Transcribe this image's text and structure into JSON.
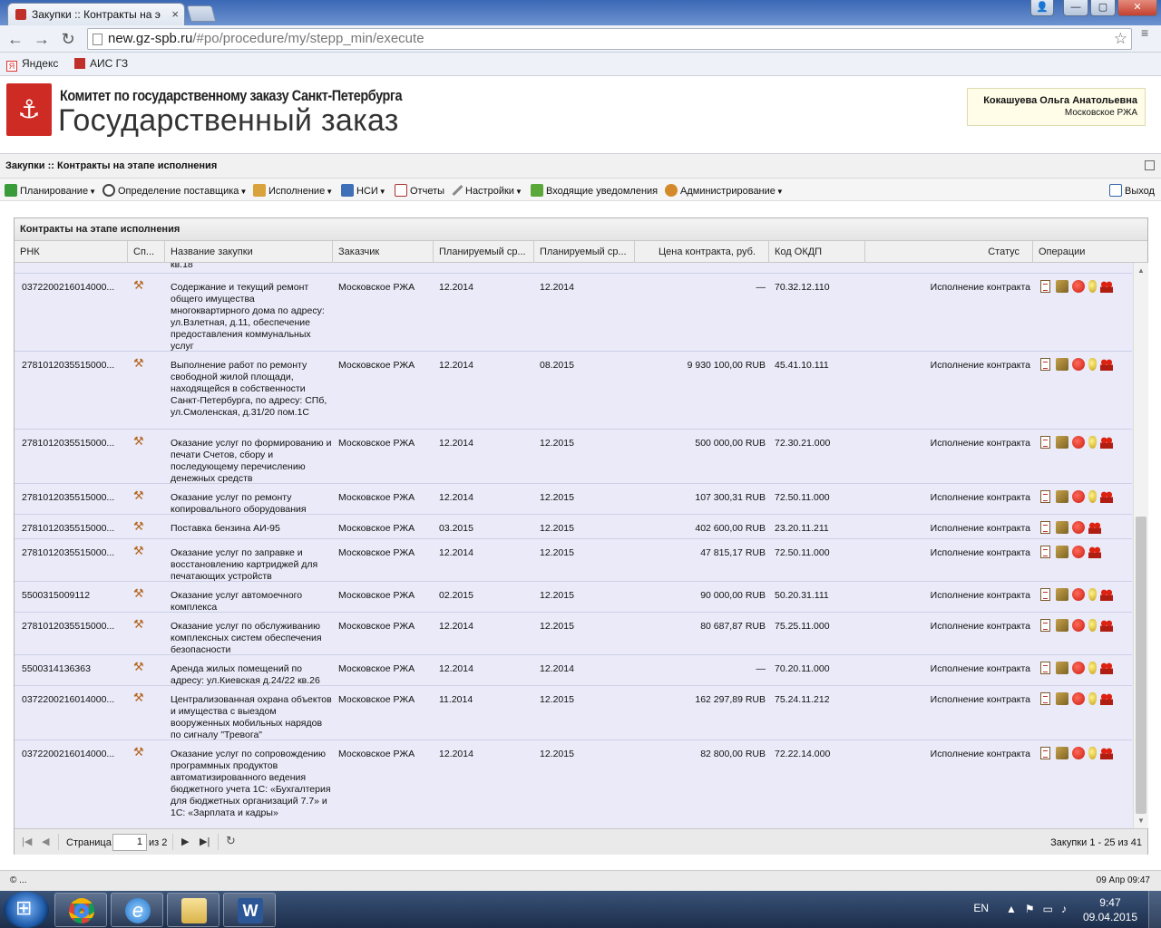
{
  "browser": {
    "tab_title": "Закупки :: Контракты на э",
    "url_domain": "new.gz-spb.ru",
    "url_path": "/#po/procedure/my/stepp_min/execute",
    "bookmarks": [
      "Яндекс",
      "АИС ГЗ"
    ]
  },
  "header": {
    "org_title": "Комитет по государственному заказу Санкт-Петербурга",
    "app_title": "Государственный заказ",
    "user_name": "Кокашуева Ольга Анатольевна",
    "user_org": "Московское РЖА"
  },
  "appbar": {
    "title": "Закупки :: Контракты на этапе исполнения"
  },
  "menu": {
    "items": [
      {
        "label": "Планирование",
        "icon": "planning-icon",
        "dropdown": true
      },
      {
        "label": "Определение поставщика",
        "icon": "supplier-icon",
        "dropdown": true
      },
      {
        "label": "Исполнение",
        "icon": "execution-icon",
        "dropdown": true
      },
      {
        "label": "НСИ",
        "icon": "reference-book-icon",
        "dropdown": true
      },
      {
        "label": "Отчеты",
        "icon": "reports-icon",
        "dropdown": false
      },
      {
        "label": "Настройки",
        "icon": "settings-icon",
        "dropdown": true
      },
      {
        "label": "Входящие уведомления",
        "icon": "notifications-icon",
        "dropdown": false
      },
      {
        "label": "Администрирование",
        "icon": "admin-icon",
        "dropdown": true
      }
    ],
    "logout": "Выход"
  },
  "grid": {
    "title": "Контракты на этапе исполнения",
    "columns": [
      "РНК",
      "Сп...",
      "Название закупки",
      "Заказчик",
      "Планируемый ср...",
      "Планируемый ср...",
      "Цена контракта, руб.",
      "Код ОКДП",
      "Статус",
      "Операции"
    ],
    "partial_row_text": "кв.18",
    "rows": [
      {
        "rnk": "0372200216014000...",
        "name": "Содержание и текущий ремонт общего имущества многоквартирного дома по адресу: ул.Взлетная, д.11, обеспечение предоставления коммунальных услуг",
        "customer": "Московское РЖА",
        "d1": "12.2014",
        "d2": "12.2014",
        "price": "—",
        "okdp": "70.32.12.110",
        "status": "Исполнение контракта",
        "coin": true
      },
      {
        "rnk": "2781012035515000...",
        "name": "Выполнение работ по ремонту свободной жилой площади, находящейся в собственности Санкт-Петербурга, по адресу: СПб, ул.Смоленская, д.31/20 пом.1С",
        "customer": "Московское РЖА",
        "d1": "12.2014",
        "d2": "08.2015",
        "price": "9 930 100,00 RUB",
        "okdp": "45.41.10.111",
        "status": "Исполнение контракта",
        "coin": true
      },
      {
        "rnk": "2781012035515000...",
        "name": "Оказание услуг по формированию и печати Счетов, сбору и последующему перечислению денежных средств",
        "customer": "Московское РЖА",
        "d1": "12.2014",
        "d2": "12.2015",
        "price": "500 000,00 RUB",
        "okdp": "72.30.21.000",
        "status": "Исполнение контракта",
        "coin": true
      },
      {
        "rnk": "2781012035515000...",
        "name": "Оказание услуг по ремонту копировального оборудования",
        "customer": "Московское РЖА",
        "d1": "12.2014",
        "d2": "12.2015",
        "price": "107 300,31 RUB",
        "okdp": "72.50.11.000",
        "status": "Исполнение контракта",
        "coin": true
      },
      {
        "rnk": "2781012035515000...",
        "name": "Поставка бензина АИ-95",
        "customer": "Московское РЖА",
        "d1": "03.2015",
        "d2": "12.2015",
        "price": "402 600,00 RUB",
        "okdp": "23.20.11.211",
        "status": "Исполнение контракта",
        "coin": false
      },
      {
        "rnk": "2781012035515000...",
        "name": "Оказание услуг по заправке и восстановлению картриджей для печатающих устройств",
        "customer": "Московское РЖА",
        "d1": "12.2014",
        "d2": "12.2015",
        "price": "47 815,17 RUB",
        "okdp": "72.50.11.000",
        "status": "Исполнение контракта",
        "coin": false
      },
      {
        "rnk": "5500315009112",
        "name": "Оказание услуг автомоечного комплекса",
        "customer": "Московское РЖА",
        "d1": "02.2015",
        "d2": "12.2015",
        "price": "90 000,00 RUB",
        "okdp": "50.20.31.111",
        "status": "Исполнение контракта",
        "coin": true
      },
      {
        "rnk": "2781012035515000...",
        "name": "Оказание услуг по обслуживанию комплексных систем обеспечения безопасности",
        "customer": "Московское РЖА",
        "d1": "12.2014",
        "d2": "12.2015",
        "price": "80 687,87 RUB",
        "okdp": "75.25.11.000",
        "status": "Исполнение контракта",
        "coin": true
      },
      {
        "rnk": "5500314136363",
        "name": "Аренда жилых помещений по адресу: ул.Киевская д.24/22 кв.26",
        "customer": "Московское РЖА",
        "d1": "12.2014",
        "d2": "12.2014",
        "price": "—",
        "okdp": "70.20.11.000",
        "status": "Исполнение контракта",
        "coin": true
      },
      {
        "rnk": "0372200216014000...",
        "name": "Централизованная охрана объектов и имущества с выездом вооруженных мобильных нарядов по сигналу \"Тревога\"",
        "customer": "Московское РЖА",
        "d1": "11.2014",
        "d2": "12.2015",
        "price": "162 297,89 RUB",
        "okdp": "75.24.11.212",
        "status": "Исполнение контракта",
        "coin": true
      },
      {
        "rnk": "0372200216014000...",
        "name": "Оказание услуг по сопровождению программных продуктов автоматизированного ведения бюджетного учета 1С: «Бухгалтерия для бюджетных организаций 7.7» и 1С: «Зарплата и кадры»",
        "customer": "Московское РЖА",
        "d1": "12.2014",
        "d2": "12.2015",
        "price": "82 800,00 RUB",
        "okdp": "72.22.14.000",
        "status": "Исполнение контракта",
        "coin": true
      }
    ]
  },
  "pager": {
    "page_label": "Страница",
    "page_value": "1",
    "of_label": "из 2",
    "info": "Закупки 1 - 25 из 41"
  },
  "footer": {
    "left": "© ...",
    "right": "09 Апр 09:47"
  },
  "taskbar": {
    "lang": "EN",
    "time": "9:47",
    "date": "09.04.2015"
  }
}
